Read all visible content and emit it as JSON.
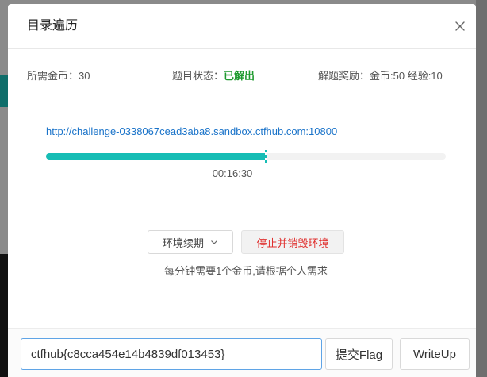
{
  "dialog": {
    "title": "目录遍历"
  },
  "info": {
    "coins_label": "所需金币：",
    "coins_value": "30",
    "status_label": "题目状态：",
    "status_value": "已解出",
    "reward_label": "解题奖励：",
    "reward_value": "金币:50 经验:10"
  },
  "challenge": {
    "url": "http://challenge-0338067cead3aba8.sandbox.ctfhub.com:10800",
    "timer": "00:16:30",
    "progress": 0.55
  },
  "actions": {
    "renew_label": "环境续期",
    "destroy_label": "停止并销毁环境",
    "cost_note": "每分钟需要1个金币,请根据个人需求"
  },
  "footer": {
    "flag_value": "ctfhub{c8cca454e14b4839df013453}",
    "submit_label": "提交Flag",
    "writeup_label": "WriteUp"
  },
  "colors": {
    "accent": "#17bdb5",
    "link": "#1a73c9",
    "status_solved": "#1e9a2e",
    "danger": "#e0302e"
  }
}
